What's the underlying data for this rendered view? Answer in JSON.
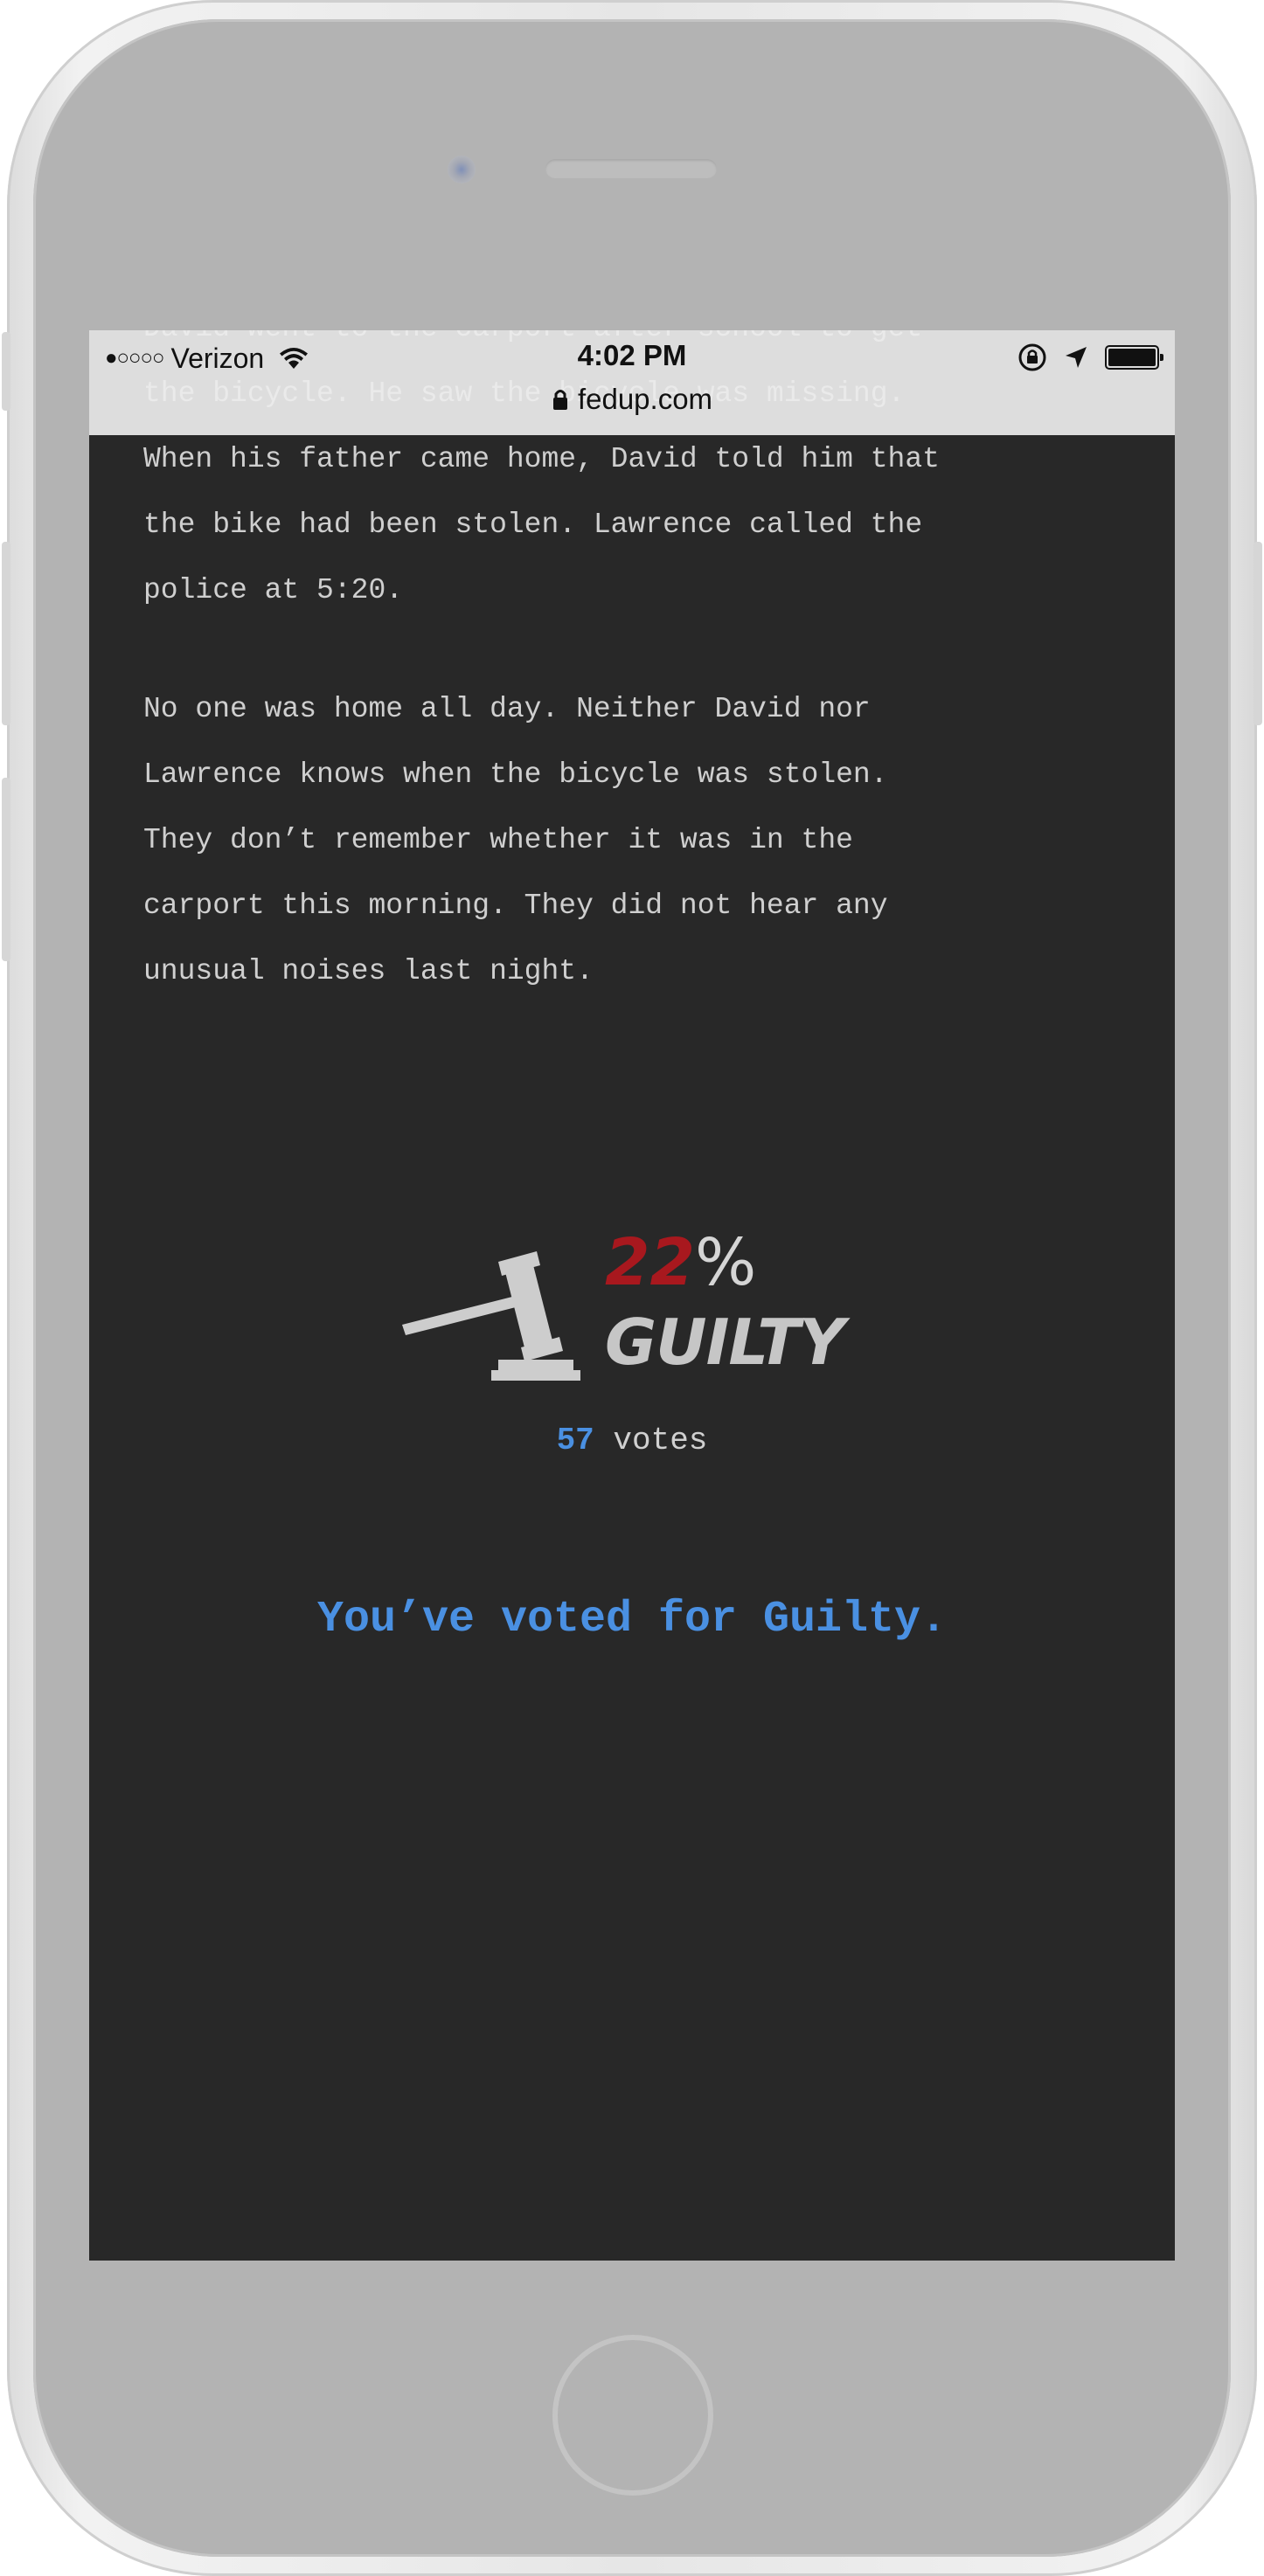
{
  "status_bar": {
    "signal": "●○○○○",
    "carrier": "Verizon",
    "time": "4:02 PM",
    "url": "fedup.com"
  },
  "story": {
    "paragraphs": [
      "David went to the carport after school to get\nthe bicycle. He saw the bicycle was missing.\nWhen his father came home, David told him that\nthe bike had been stolen. Lawrence called the\npolice at 5:20.",
      "No one was home all day. Neither David nor\nLawrence knows when the bicycle was stolen.\nThey don’t remember whether it was in the\ncarport this morning. They did not hear any\nunusual noises last night."
    ]
  },
  "result": {
    "percent": "22",
    "percent_sign": "%",
    "verdict": "GUILTY",
    "votes_count": "57",
    "votes_label": "votes",
    "message": "You’ve voted for Guilty."
  },
  "colors": {
    "background": "#282828",
    "percent": "#a8181e",
    "accent": "#4a90e2"
  }
}
